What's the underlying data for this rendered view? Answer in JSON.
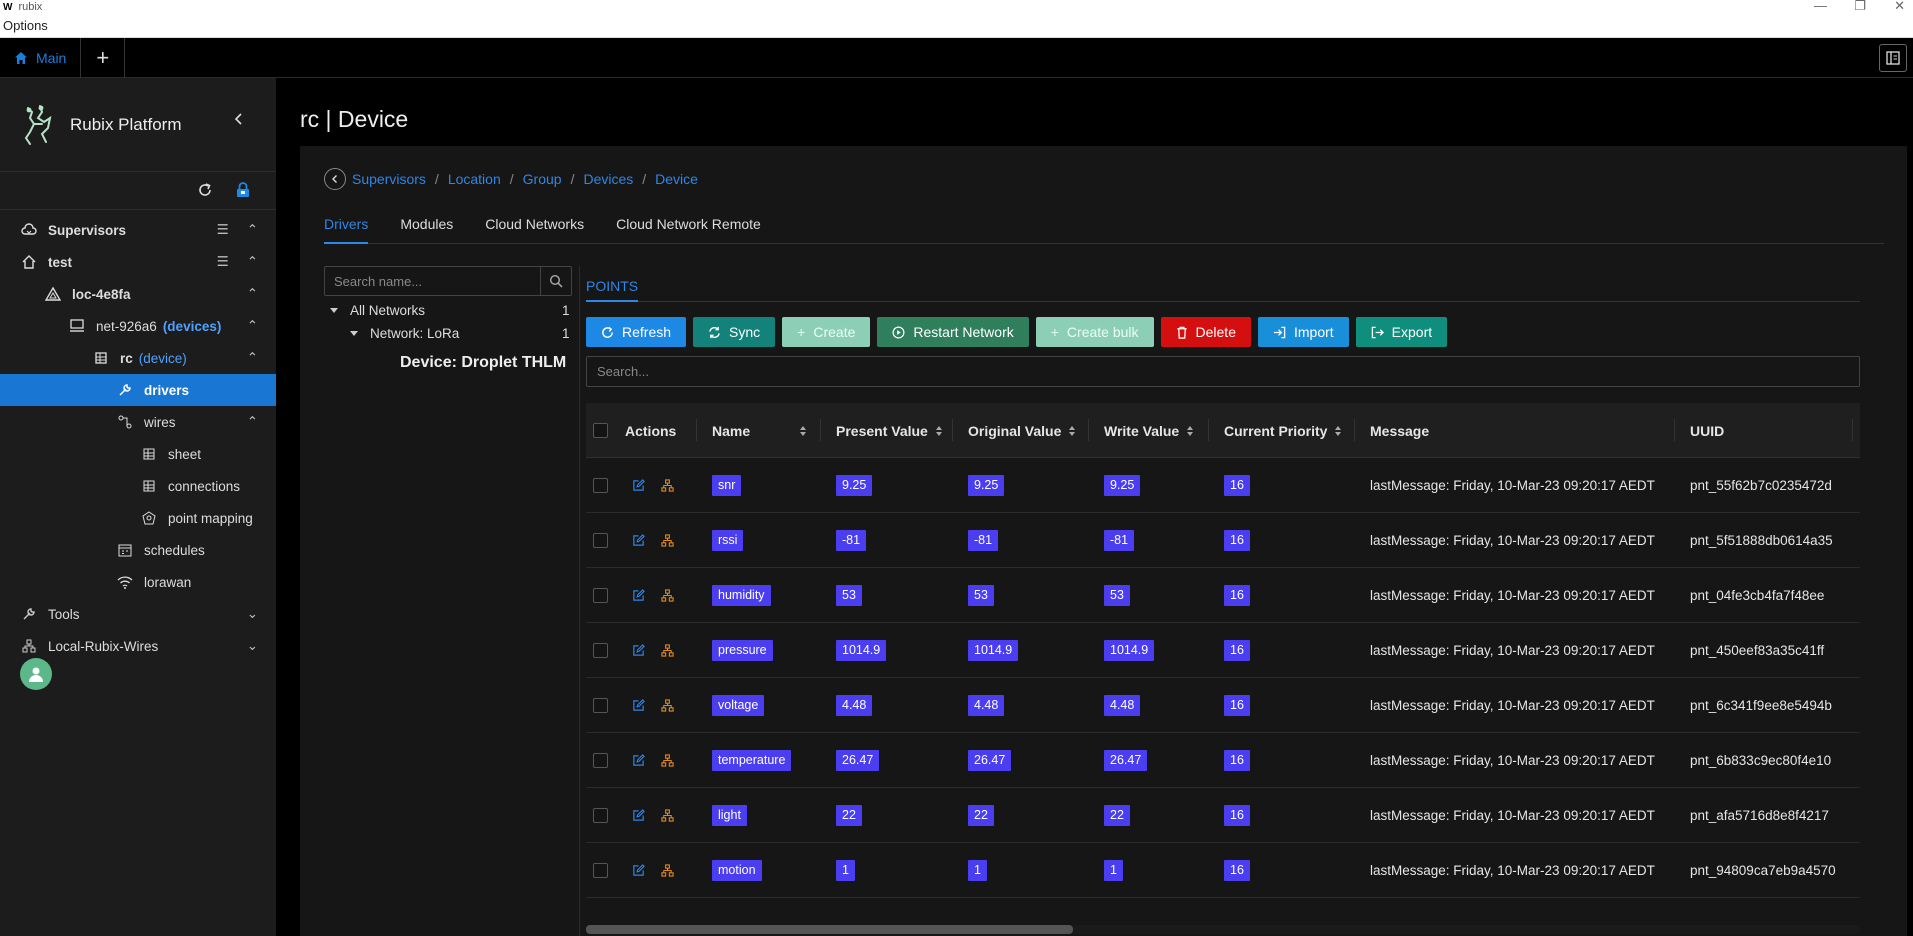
{
  "window": {
    "app_title": "rubix",
    "menu_options": "Options"
  },
  "tabbar": {
    "main_tab": "Main",
    "add_tab": "+"
  },
  "sidebar": {
    "brand": "Rubix Platform",
    "tree": [
      {
        "label": "Supervisors",
        "icon": "cloud-icon"
      },
      {
        "label": "test",
        "icon": "home-icon"
      },
      {
        "label": "loc-4e8fa",
        "icon": "location-icon"
      },
      {
        "label": "net-926a6",
        "suffix": "(devices)",
        "icon": "computer-icon"
      },
      {
        "label": "rc",
        "suffix": "(device)",
        "icon": "device-icon"
      },
      {
        "label": "drivers",
        "icon": "wrench-icon"
      },
      {
        "label": "wires",
        "icon": "wires-icon"
      },
      {
        "label": "sheet",
        "icon": "sheet-icon"
      },
      {
        "label": "connections",
        "icon": "connections-icon"
      },
      {
        "label": "point mapping",
        "icon": "point-mapping-icon"
      },
      {
        "label": "schedules",
        "icon": "schedules-icon"
      },
      {
        "label": "lorawan",
        "icon": "wifi-icon"
      },
      {
        "label": "Tools",
        "icon": "tools-icon"
      },
      {
        "label": "Local-Rubix-Wires",
        "icon": "wires-icon"
      }
    ]
  },
  "main": {
    "title": "rc | Device",
    "breadcrumb": [
      "Supervisors",
      "Location",
      "Group",
      "Devices",
      "Device"
    ],
    "tabs": [
      "Drivers",
      "Modules",
      "Cloud Networks",
      "Cloud Network Remote"
    ],
    "tree_search_placeholder": "Search name...",
    "all_networks": {
      "label": "All Networks",
      "count": "1"
    },
    "network": {
      "label": "Network: LoRa",
      "count": "1"
    },
    "device_label": "Device: Droplet THLM",
    "points_tab": "POINTS",
    "toolbar": {
      "refresh": "Refresh",
      "sync": "Sync",
      "create": "Create",
      "restart": "Restart Network",
      "create_bulk": "Create bulk",
      "delete": "Delete",
      "import": "Import",
      "export": "Export"
    },
    "points_search_placeholder": "Search...",
    "columns": [
      "Actions",
      "Name",
      "Present Value",
      "Original Value",
      "Write Value",
      "Current Priority",
      "Message",
      "UUID"
    ],
    "rows": [
      {
        "name": "snr",
        "present": "9.25",
        "original": "9.25",
        "write": "9.25",
        "priority": "16",
        "message": "lastMessage: Friday, 10-Mar-23 09:20:17 AEDT",
        "uuid": "pnt_55f62b7c0235472d"
      },
      {
        "name": "rssi",
        "present": "-81",
        "original": "-81",
        "write": "-81",
        "priority": "16",
        "message": "lastMessage: Friday, 10-Mar-23 09:20:17 AEDT",
        "uuid": "pnt_5f51888db0614a35"
      },
      {
        "name": "humidity",
        "present": "53",
        "original": "53",
        "write": "53",
        "priority": "16",
        "message": "lastMessage: Friday, 10-Mar-23 09:20:17 AEDT",
        "uuid": "pnt_04fe3cb4fa7f48ee"
      },
      {
        "name": "pressure",
        "present": "1014.9",
        "original": "1014.9",
        "write": "1014.9",
        "priority": "16",
        "message": "lastMessage: Friday, 10-Mar-23 09:20:17 AEDT",
        "uuid": "pnt_450eef83a35c41ff"
      },
      {
        "name": "voltage",
        "present": "4.48",
        "original": "4.48",
        "write": "4.48",
        "priority": "16",
        "message": "lastMessage: Friday, 10-Mar-23 09:20:17 AEDT",
        "uuid": "pnt_6c341f9ee8e5494b"
      },
      {
        "name": "temperature",
        "present": "26.47",
        "original": "26.47",
        "write": "26.47",
        "priority": "16",
        "message": "lastMessage: Friday, 10-Mar-23 09:20:17 AEDT",
        "uuid": "pnt_6b833c9ec80f4e10"
      },
      {
        "name": "light",
        "present": "22",
        "original": "22",
        "write": "22",
        "priority": "16",
        "message": "lastMessage: Friday, 10-Mar-23 09:20:17 AEDT",
        "uuid": "pnt_afa5716d8e8f4217"
      },
      {
        "name": "motion",
        "present": "1",
        "original": "1",
        "write": "1",
        "priority": "16",
        "message": "lastMessage: Friday, 10-Mar-23 09:20:17 AEDT",
        "uuid": "pnt_94809ca7eb9a4570"
      }
    ]
  },
  "colors": {
    "accent": "#1976d2",
    "link": "#2e86e6",
    "tag": "#4a3ef0",
    "delete": "#d40f0f",
    "edit_icon": "#2e86e6",
    "tree_icon": "#e08a1e"
  }
}
